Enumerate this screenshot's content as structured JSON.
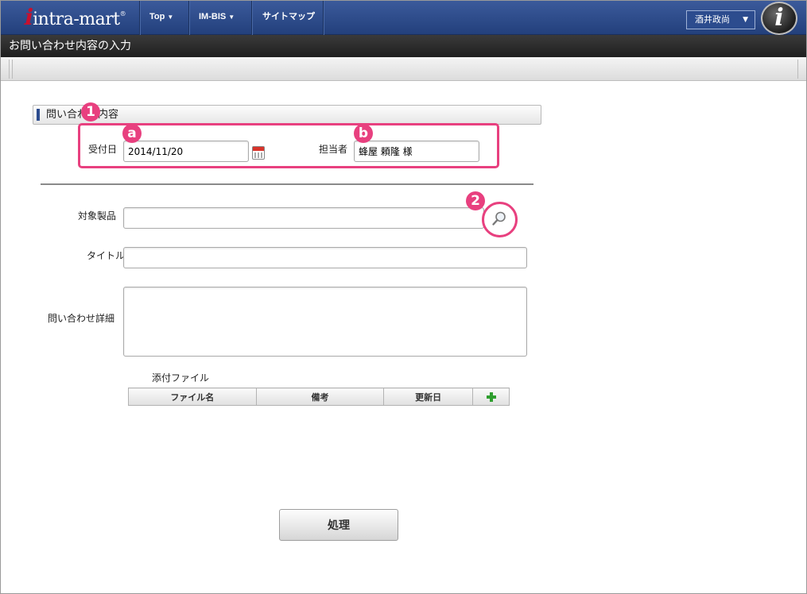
{
  "header": {
    "logo_text": "intra-mart",
    "logo_mark": "®",
    "nav": [
      {
        "label": "Top",
        "caret": "▼"
      },
      {
        "label": "IM-BIS",
        "caret": "▼"
      },
      {
        "label": "サイトマップ"
      }
    ],
    "user_name": "酒井政尚",
    "user_caret": "▼",
    "info_icon_glyph": "i"
  },
  "page": {
    "title": "お問い合わせ内容の入力"
  },
  "section": {
    "title": "問い合わせ内容"
  },
  "form": {
    "receipt_date_label": "受付日",
    "receipt_date_value": "2014/11/20",
    "assignee_label": "担当者",
    "assignee_value": "蜂屋 頼隆 様",
    "product_label": "対象製品",
    "product_value": "",
    "title_label": "タイトル",
    "title_value": "",
    "detail_label": "問い合わせ詳細",
    "detail_value": ""
  },
  "attachments": {
    "label": "添付ファイル",
    "columns": [
      "ファイル名",
      "備考",
      "更新日"
    ]
  },
  "actions": {
    "process_label": "処理"
  },
  "annotations": {
    "badge_1": "1",
    "badge_a": "a",
    "badge_b": "b",
    "badge_2": "2",
    "color": "#e8407f"
  },
  "colors": {
    "nav_bg": "#2c4c8e",
    "title_bg": "#2a2a2a",
    "accent": "#2c4c8e",
    "add_green": "#2f9e2f"
  }
}
